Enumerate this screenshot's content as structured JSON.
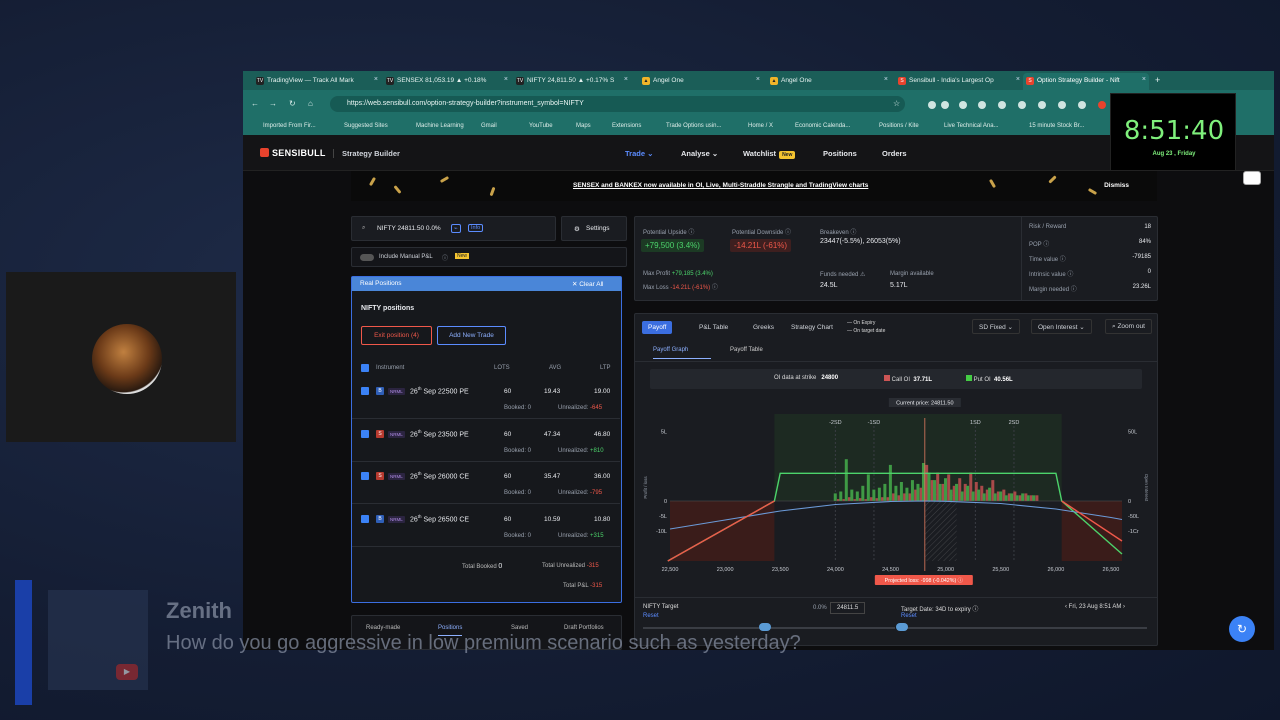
{
  "tabs": [
    {
      "label": "TradingView — Track All Mark",
      "icon": "TV"
    },
    {
      "label": "SENSEX 81,053.19 ▲ +0.18%",
      "icon": "TV"
    },
    {
      "label": "NIFTY 24,811.50 ▲ +0.17% S",
      "icon": "TV"
    },
    {
      "label": "Angel One",
      "icon": "A"
    },
    {
      "label": "Angel One",
      "icon": "A"
    },
    {
      "label": "Sensibull - India's Largest Op",
      "icon": "S"
    },
    {
      "label": "Option Strategy Builder - Nift",
      "icon": "S"
    }
  ],
  "url": "https://web.sensibull.com/option-strategy-builder?instrument_symbol=NIFTY",
  "bookmarks": [
    "Imported From Fir...",
    "Suggested Sites",
    "Machine Learning",
    "Gmail",
    "YouTube",
    "Maps",
    "Extensions",
    "Trade Options usin...",
    "Home / X",
    "Economic Calenda...",
    "Positions / Kite",
    "Live Technical Ana...",
    "15 minute Stock Br..."
  ],
  "clock": {
    "time": "8:51:40",
    "date": "Aug 23 , Friday"
  },
  "app": {
    "logo": "SENSIBULL",
    "section": "Strategy Builder",
    "nav": [
      "Trade ⌄",
      "Analyse ⌄",
      "Watchlist",
      "Positions",
      "Orders"
    ],
    "new_badge": "New"
  },
  "banner": {
    "text": "SENSEX and BANKEX now available in OI, Live, Multi-Straddle Strangle and TradingView charts",
    "dismiss": "Dismiss"
  },
  "search": {
    "value": "NIFTY 24811.50 0.0%",
    "info": "Info",
    "settings": "Settings"
  },
  "manual_pl": {
    "label": "Include Manual P&L",
    "badge": "New"
  },
  "positions": {
    "header": "Real Positions",
    "clear": "✕ Clear All",
    "title": "NIFTY positions",
    "exit_btn": "Exit position (4)",
    "add_btn": "Add New Trade",
    "cols": [
      "Instrument",
      "LOTS",
      "AVG",
      "LTP"
    ],
    "rows": [
      {
        "side": "B",
        "type": "NRML",
        "day": "26",
        "sup": "th",
        "name": "Sep 22500 PE",
        "lots": "60",
        "avg": "19.43",
        "ltp": "19.00",
        "booked": "Booked: 0",
        "unreal_lbl": "Unrealized: ",
        "unreal": "-645",
        "cls": "red"
      },
      {
        "side": "S",
        "type": "NRML",
        "day": "26",
        "sup": "th",
        "name": "Sep 23500 PE",
        "lots": "60",
        "avg": "47.34",
        "ltp": "46.80",
        "booked": "Booked: 0",
        "unreal_lbl": "Unrealized: ",
        "unreal": "+810",
        "cls": "green"
      },
      {
        "side": "S",
        "type": "NRML",
        "day": "26",
        "sup": "th",
        "name": "Sep 26000 CE",
        "lots": "60",
        "avg": "35.47",
        "ltp": "36.00",
        "booked": "Booked: 0",
        "unreal_lbl": "Unrealized: ",
        "unreal": "-795",
        "cls": "red"
      },
      {
        "side": "B",
        "type": "NRML",
        "day": "26",
        "sup": "th",
        "name": "Sep 26500 CE",
        "lots": "60",
        "avg": "10.59",
        "ltp": "10.80",
        "booked": "Booked: 0",
        "unreal_lbl": "Unrealized: ",
        "unreal": "+315",
        "cls": "green"
      }
    ],
    "total_booked_lbl": "Total Booked",
    "total_booked": "0",
    "total_unreal_lbl": "Total Unrealized",
    "total_unreal": "-315",
    "total_pl_lbl": "Total P&L",
    "total_pl": "-315"
  },
  "bottom_tabs": [
    "Ready-made",
    "Positions",
    "Saved",
    "Draft Portfolios"
  ],
  "stats": {
    "upside_lbl": "Potential Upside ⓘ",
    "upside": "+79,500 (3.4%)",
    "downside_lbl": "Potential Downside ⓘ",
    "downside": "-14.21L (-61%)",
    "breakeven_lbl": "Breakeven ⓘ",
    "breakeven": "23447(-5.5%),  26053(5%)",
    "maxprofit_lbl": "Max Profit",
    "maxprofit": "+79,185 (3.4%)",
    "maxloss_lbl": "Max Loss",
    "maxloss": "-14.21L (-61%)",
    "funds_lbl": "Funds needed ⚠",
    "funds": "24.5L",
    "margin_lbl": "Margin available",
    "margin": "5.17L",
    "right": [
      {
        "k": "Risk / Reward",
        "v": "18"
      },
      {
        "k": "POP ⓘ",
        "v": "84%"
      },
      {
        "k": "Time value ⓘ",
        "v": "-79185"
      },
      {
        "k": "Intrinsic value ⓘ",
        "v": "0"
      },
      {
        "k": "Margin needed ⓘ",
        "v": "23.26L"
      }
    ]
  },
  "chart_tabs": [
    "Payoff",
    "P&L Table",
    "Greeks",
    "Strategy Chart"
  ],
  "legend": [
    "— On Expiry",
    "— On target date"
  ],
  "sd": "SD Fixed ⌄",
  "oi_sel": "Open Interest ⌄",
  "zoom": "Zoom out",
  "subtabs": [
    "Payoff Graph",
    "Payoff Table"
  ],
  "oi_bar": {
    "strike_lbl": "OI data at strike",
    "strike": "24800",
    "call_lbl": "Call OI",
    "call": "37.71L",
    "put_lbl": "Put OI",
    "put": "40.56L"
  },
  "current_price": "Current price: 24811.50",
  "sd_labels": [
    "-2SD",
    "-1SD",
    "1SD",
    "2SD"
  ],
  "projected": "Projected loss: -998 (-0.042%) ⓘ",
  "left_axis": {
    "label": "Profit / loss",
    "ticks": [
      "5L",
      "0",
      "-5L",
      "-10L"
    ]
  },
  "right_axis": {
    "label": "Open Interest",
    "ticks": [
      "50L",
      "0",
      "-50L",
      "-1Cr"
    ]
  },
  "chart_data": {
    "type": "line",
    "x": [
      22500,
      23000,
      23500,
      24000,
      24500,
      25000,
      25500,
      26000,
      26500
    ],
    "xticks": [
      "22,500",
      "23,000",
      "23,500",
      "24,000",
      "24,500",
      "25,000",
      "25,500",
      "26,000",
      "26,500"
    ],
    "xlim": [
      22500,
      26600
    ],
    "ylim": [
      -1000000,
      250000
    ],
    "series": [
      {
        "name": "On Expiry",
        "x": [
          22480,
          23447,
          23500,
          26000,
          26053,
          26600
        ],
        "values": [
          -1420000,
          0,
          79500,
          79500,
          0,
          -1060000
        ],
        "color": "#4cd36b"
      },
      {
        "name": "On target date",
        "x": [
          22500,
          23000,
          23500,
          24000,
          24500,
          24811.5,
          25000,
          25500,
          26000,
          26500,
          26600
        ],
        "values": [
          -560000,
          -380000,
          -200000,
          -70000,
          -10000,
          -998,
          -5000,
          -50000,
          -160000,
          -330000,
          -370000
        ],
        "color": "#6b9ad8"
      }
    ],
    "current_price": 24811.5
  },
  "oi_bars": {
    "strikes": [
      24000,
      24050,
      24100,
      24150,
      24200,
      24250,
      24300,
      24350,
      24400,
      24450,
      24500,
      24550,
      24600,
      24650,
      24700,
      24750,
      24800,
      24850,
      24900,
      24950,
      25000,
      25050,
      25100,
      25150,
      25200,
      25250,
      25300,
      25350,
      25400,
      25450,
      25500,
      25550,
      25600,
      25650,
      25700,
      25750,
      25800
    ],
    "put": [
      8,
      10,
      44,
      12,
      10,
      16,
      28,
      12,
      14,
      18,
      38,
      16,
      20,
      14,
      22,
      18,
      40,
      30,
      22,
      18,
      24,
      12,
      18,
      10,
      16,
      10,
      12,
      8,
      14,
      8,
      10,
      6,
      8,
      6,
      8,
      6,
      6
    ],
    "call": [
      2,
      2,
      4,
      2,
      3,
      2,
      4,
      3,
      4,
      4,
      8,
      6,
      8,
      8,
      12,
      14,
      38,
      22,
      30,
      18,
      28,
      16,
      24,
      18,
      30,
      20,
      16,
      12,
      22,
      10,
      12,
      8,
      10,
      6,
      8,
      6,
      6
    ]
  },
  "footer": {
    "nifty_lbl": "NIFTY Target",
    "reset": "Reset",
    "pct": "0.0%",
    "target": "24811.5",
    "date_lbl": "Target Date: 34D to expiry ⓘ",
    "date": "‹  Fri, 23 Aug 8:51 AM  ›",
    "reset2": "Reset"
  },
  "overlay": {
    "name": "Zenith",
    "message": "How do you go aggressive in low premium scenario such as yesterday?"
  },
  "colors": {
    "accent": "#3b6ee0",
    "profit": "#4cd36b",
    "loss": "#f0584a",
    "tabbar": "#1b5e58"
  }
}
